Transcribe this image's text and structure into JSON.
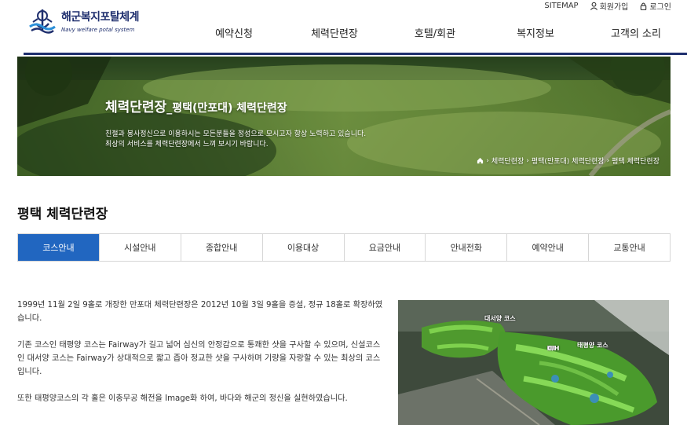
{
  "site": {
    "name": "해군복지포탈체계",
    "subtitle": "Navy welfare potal system"
  },
  "util": {
    "sitemap": "SITEMAP",
    "join": "회원가입",
    "login": "로그인"
  },
  "gnb": [
    "예약신청",
    "체력단련장",
    "호텔/회관",
    "복지정보",
    "고객의 소리"
  ],
  "banner": {
    "title_main": "체력단련장",
    "title_sub": "_평택(만포대) 체력단련장",
    "desc_line1": "친절과 봉사정신으로 이용하시는 모든분들을 정성으로 모시고자 항상 노력하고 있습니다.",
    "desc_line2": "최상의 서비스를 체력단련장에서 느껴 보시기 바랍니다.",
    "breadcrumb": [
      "체력단련장",
      "평택(만포대) 체력단련장",
      "평택 체력단련장"
    ]
  },
  "page_title": "평택 체력단련장",
  "tabs": [
    "코스안내",
    "시설안내",
    "종합안내",
    "이용대상",
    "요금안내",
    "안내전화",
    "예약안내",
    "교통안내"
  ],
  "active_tab": 0,
  "content": {
    "p1": "1999년 11월 2일 9홀로 개장한 만포대 체력단련장은 2012년 10월 3일 9홀을 증설, 정규 18홀로 확장하였습니다.",
    "p2": "기존 코스인 태평양 코스는 Fairway가 길고 넓어 심신의 안정감으로 통쾌한 샷을 구사할 수 있으며, 신설코스인 대서양 코스는 Fairway가 상대적으로 짧고 좁아 정교한 샷을 구사하며 기량을 자랑할 수 있는 최상의 코스입니다.",
    "p3": "또한 태평양코스의 각 홀은 이충무공 해전을 Image화 하여, 바다와 해군의 정신을 실현하였습니다."
  },
  "map_labels": {
    "atlantic": "대서양 코스",
    "pacific": "태평양 코스",
    "clubhouse": "C/H"
  },
  "colors": {
    "navy": "#1f2f6e",
    "tab_active": "#2166c0"
  }
}
